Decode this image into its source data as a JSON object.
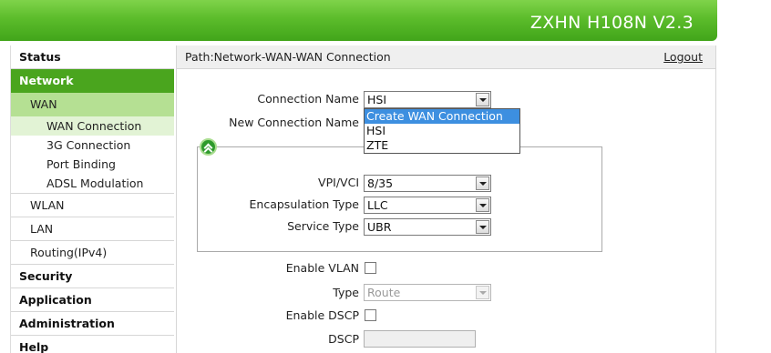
{
  "header": {
    "title": "ZXHN H108N V2.3"
  },
  "sidebar": {
    "status": "Status",
    "network": "Network",
    "wan": "WAN",
    "wan_connection": "WAN Connection",
    "g3_connection": "3G Connection",
    "port_binding": "Port Binding",
    "adsl_modulation": "ADSL Modulation",
    "wlan": "WLAN",
    "lan": "LAN",
    "routing": "Routing(IPv4)",
    "security": "Security",
    "application": "Application",
    "administration": "Administration",
    "help": "Help"
  },
  "pathbar": {
    "path": "Path:Network-WAN-WAN Connection",
    "logout": "Logout"
  },
  "form": {
    "connection_name_label": "Connection Name",
    "connection_name_value": "HSI",
    "connection_name_options": [
      "Create WAN Connection",
      "HSI",
      "ZTE"
    ],
    "new_connection_name_label": "New Connection Name",
    "vpi_vci_label": "VPI/VCI",
    "vpi_vci_value": "8/35",
    "encapsulation_label": "Encapsulation Type",
    "encapsulation_value": "LLC",
    "service_type_label": "Service Type",
    "service_type_value": "UBR",
    "enable_vlan_label": "Enable VLAN",
    "type_label": "Type",
    "type_value": "Route",
    "enable_dscp_label": "Enable DSCP",
    "dscp_label": "DSCP"
  },
  "colors": {
    "header_green": "#5cbc2b",
    "nav_active": "#4aa51e",
    "sub_active": "#b5e093",
    "dropdown_highlight": "#3d8fe0"
  }
}
